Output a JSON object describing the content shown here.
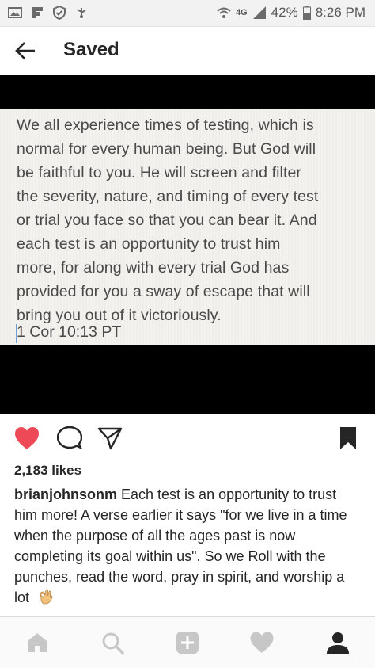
{
  "status_bar": {
    "network": "4G",
    "battery": "42%",
    "time": "8:26 PM"
  },
  "header": {
    "title": "Saved",
    "back_icon": "arrow-left-icon"
  },
  "post": {
    "quote_text": "We all experience times of testing, which is\nnormal for every human being. But God will\nbe faithful to you. He will screen and filter\nthe severity, nature, and timing of every test\nor trial you face so that you can bear it. And\neach test is an opportunity to trust him\nmore, for along with every trial God has\nprovided for you a sway of escape that will\nbring you out of it victoriously.",
    "reference": "1 Cor 10:13 PT",
    "liked": true,
    "like_color": "#ed4956"
  },
  "actions": {
    "like_icon": "heart-icon",
    "comment_icon": "comment-icon",
    "share_icon": "direct-share-icon",
    "save_icon": "bookmark-icon"
  },
  "likes": "2,183 likes",
  "caption": {
    "username": "brianjohnsonm",
    "text": "Each test is an opportunity to trust him more! A verse earlier it says \"for we live in a time when the purpose of all the ages past is now completing its goal within us\". So we Roll with the punches, read the word, pray in spirit, and worship a lot",
    "emoji": "ok-hand-emoji"
  },
  "bottom_nav": {
    "items": [
      "home-icon",
      "search-icon",
      "add-post-icon",
      "activity-heart-icon",
      "profile-icon"
    ],
    "active": "profile-icon"
  }
}
